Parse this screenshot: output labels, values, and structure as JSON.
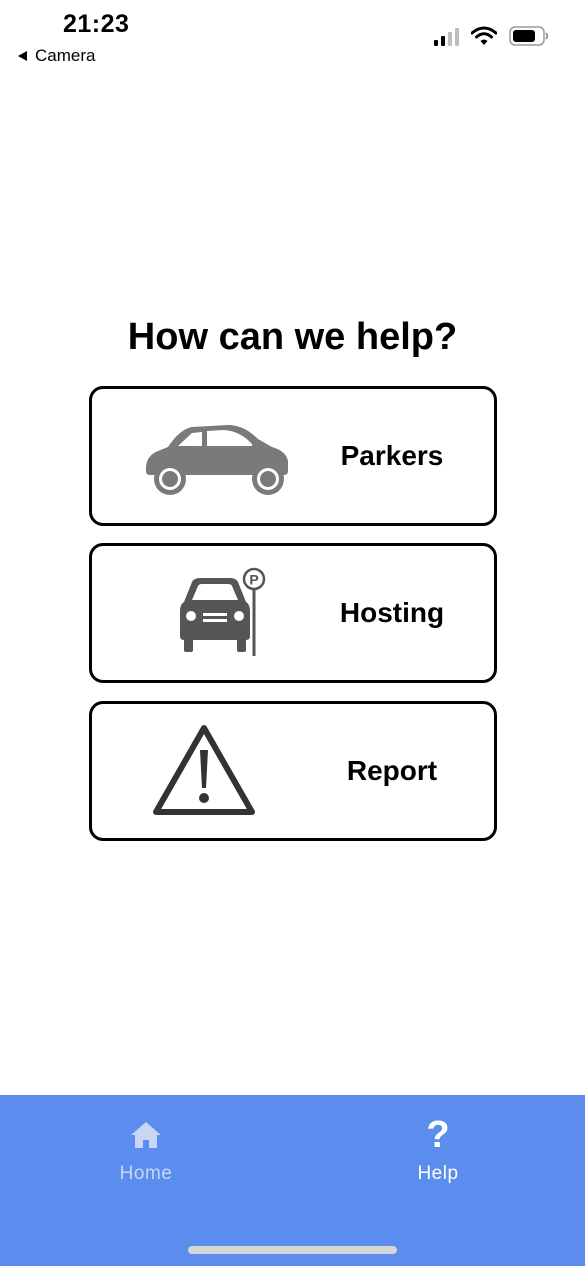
{
  "status_bar": {
    "time": "21:23",
    "back_app": "Camera"
  },
  "page": {
    "title": "How can we help?"
  },
  "options": [
    {
      "label": "Parkers",
      "icon": "car-side-icon"
    },
    {
      "label": "Hosting",
      "icon": "car-parking-sign-icon"
    },
    {
      "label": "Report",
      "icon": "warning-triangle-icon"
    }
  ],
  "tab_bar": {
    "home_label": "Home",
    "help_label": "Help",
    "help_glyph": "?",
    "home_icon": "home-icon",
    "help_icon": "question-mark-icon",
    "active": "Help",
    "background_color": "#5b8def"
  },
  "colors": {
    "icon_gray": "#7a7a7a",
    "card_border": "#000000"
  }
}
